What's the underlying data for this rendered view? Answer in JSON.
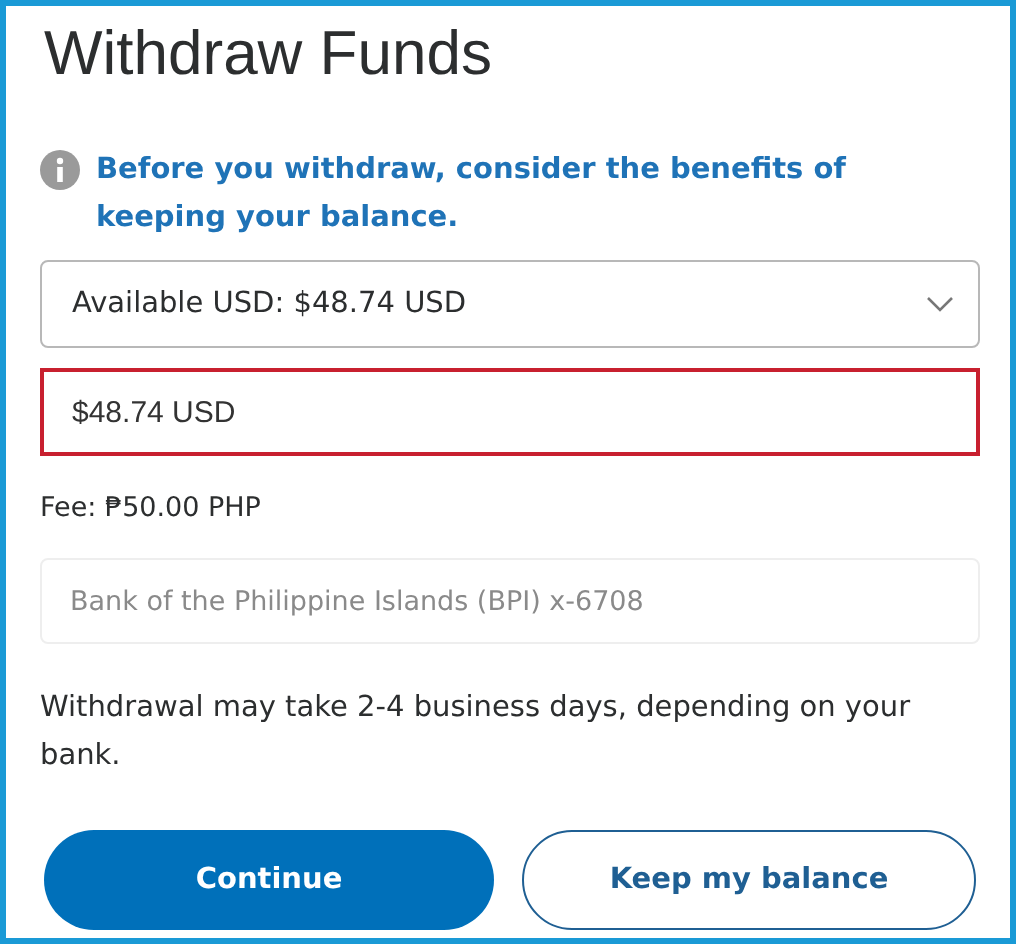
{
  "title": "Withdraw Funds",
  "notice": "Before you withdraw, consider the benefits of keeping your balance.",
  "balance_select": {
    "value": "Available USD: $48.74 USD"
  },
  "amount_field": {
    "value": "$48.74 USD",
    "error": true
  },
  "fee": "Fee: ₱50.00 PHP",
  "bank_field": {
    "placeholder": "Bank of the Philippine Islands (BPI) x-6708"
  },
  "note": "Withdrawal may take 2-4 business days, depending on your bank.",
  "buttons": [
    {
      "label": "Continue",
      "kind": "primary"
    },
    {
      "label": "Keep my balance",
      "kind": "secondary"
    }
  ]
}
